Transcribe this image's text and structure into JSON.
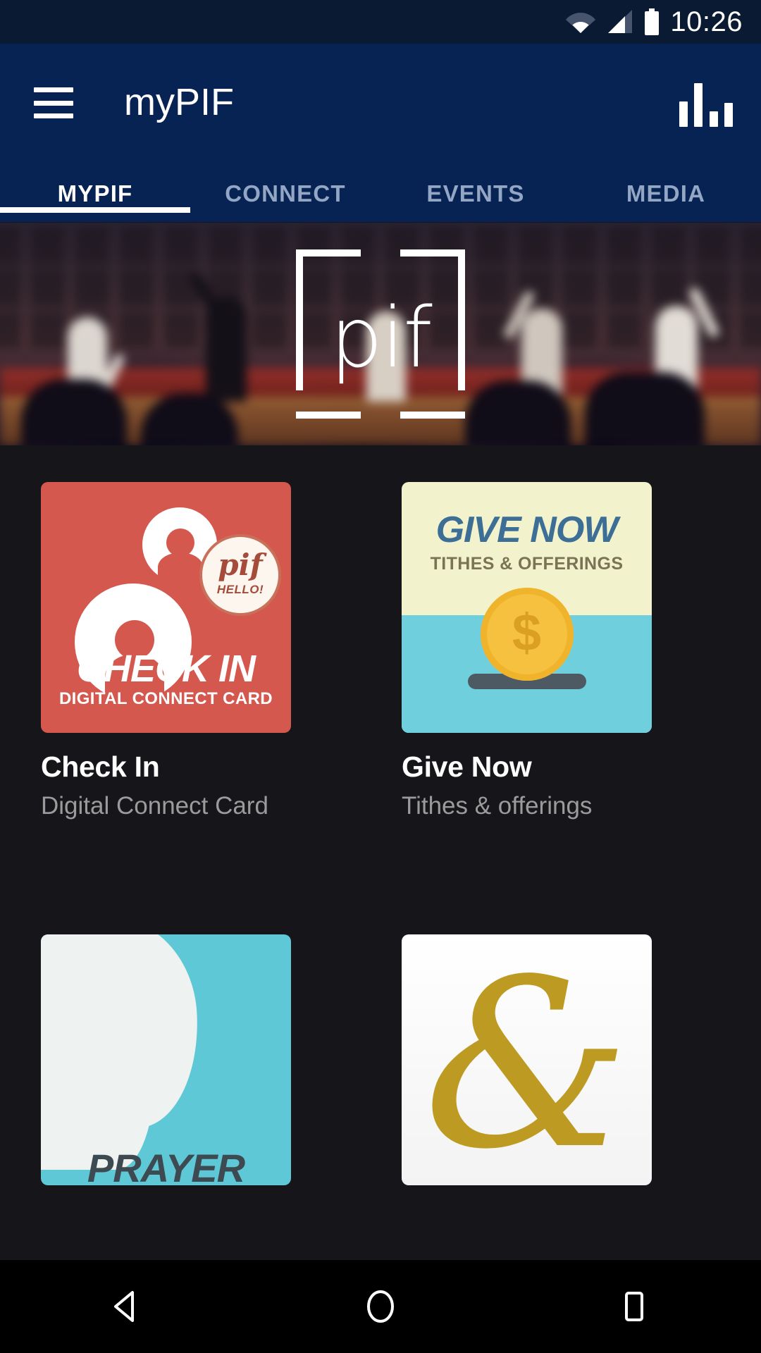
{
  "status_bar": {
    "time": "10:26",
    "icons": [
      "wifi-icon",
      "cellular-signal-icon",
      "battery-icon"
    ]
  },
  "app_bar": {
    "title": "myPIF",
    "menu_icon": "hamburger-menu-icon",
    "action_icon": "bar-chart-icon",
    "background_color": "#072354"
  },
  "tabs": {
    "items": [
      {
        "label": "MYPIF",
        "active": true
      },
      {
        "label": "CONNECT",
        "active": false
      },
      {
        "label": "EVENTS",
        "active": false
      },
      {
        "label": "MEDIA",
        "active": false
      }
    ],
    "active_color": "#ffffff",
    "inactive_color": "#93a6c4"
  },
  "hero": {
    "logo_text": "pif",
    "description": "Blurred worship service photo with pif bracket logo"
  },
  "cards": [
    {
      "title": "Check In",
      "subtitle": "Digital Connect Card",
      "tile_title": "CHECK IN",
      "tile_subtitle": "DIGITAL CONNECT CARD",
      "badge_primary": "pif",
      "badge_secondary": "HELLO!",
      "color": "#d4584e"
    },
    {
      "title": "Give Now",
      "subtitle": "Tithes & offerings",
      "tile_title": "GIVE NOW",
      "tile_subtitle": "TITHES & OFFERINGS",
      "coin_symbol": "$",
      "color": "#f2f3cd",
      "accent_color": "#3c6e96",
      "water_color": "#6fcfdc"
    },
    {
      "title": "",
      "subtitle": "",
      "tile_title": "PRAYER",
      "color": "#5ec8d6"
    },
    {
      "title": "",
      "subtitle": "",
      "tile_title": "&",
      "color": "#bd9a22"
    }
  ],
  "nav_bar": {
    "back_label": "back-icon",
    "home_label": "home-icon",
    "recents_label": "recents-icon"
  }
}
